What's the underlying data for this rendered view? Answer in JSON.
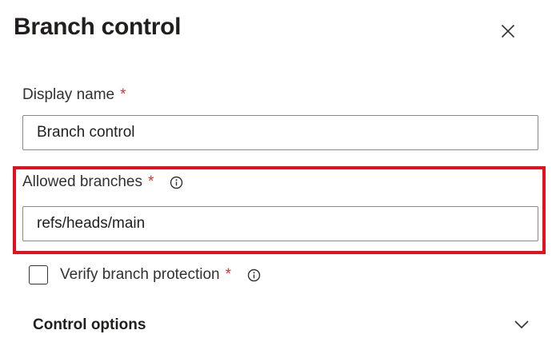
{
  "panel": {
    "title": "Branch control",
    "close_icon": "close-icon"
  },
  "display_name": {
    "label": "Display name",
    "required_mark": "*",
    "value": "Branch control"
  },
  "allowed_branches": {
    "label": "Allowed branches",
    "required_mark": "*",
    "info_icon": "info-icon",
    "value": "refs/heads/main"
  },
  "verify_branch_protection": {
    "label": "Verify branch protection",
    "required_mark": "*",
    "info_icon": "info-icon",
    "checked": false
  },
  "control_options": {
    "label": "Control options",
    "expand_icon": "chevron-down-icon"
  },
  "colors": {
    "highlight": "#e3111e",
    "required": "#d13438",
    "border": "#8a8886"
  }
}
